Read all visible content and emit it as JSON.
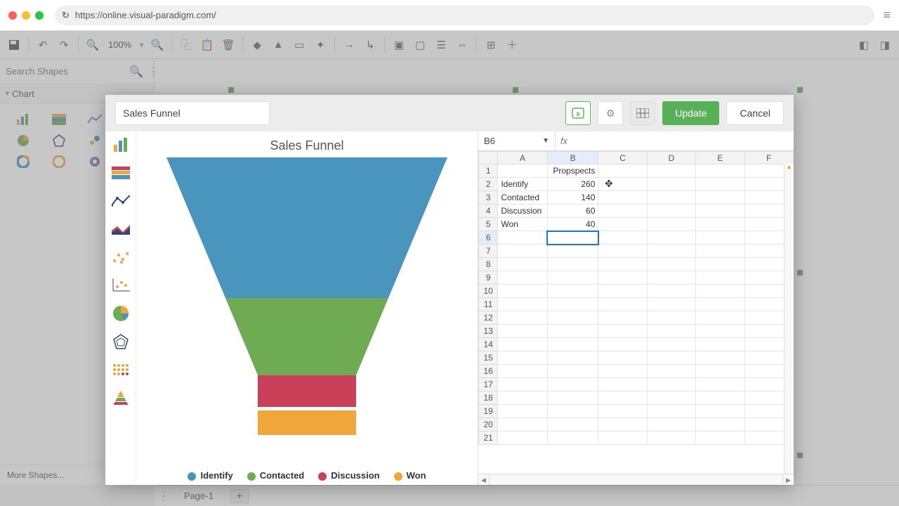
{
  "browser": {
    "url": "https://online.visual-paradigm.com/"
  },
  "toolbar": {
    "zoom": "100%"
  },
  "sidebar": {
    "search_placeholder": "Search Shapes",
    "category": "Chart",
    "more": "More Shapes..."
  },
  "page_tab": "Page-1",
  "modal": {
    "title_input": "Sales Funnel",
    "update": "Update",
    "cancel": "Cancel",
    "chart_title": "Sales Funnel"
  },
  "legend": {
    "l1": "Identify",
    "l2": "Contacted",
    "l3": "Discussion",
    "l4": "Won"
  },
  "colors": {
    "identify": "#4a95bd",
    "contacted": "#6eab52",
    "discussion": "#c94058",
    "won": "#f0a63b"
  },
  "sheet": {
    "cellref": "B6",
    "cols": [
      "A",
      "B",
      "C",
      "D",
      "E",
      "F"
    ],
    "b1": "Propspects",
    "a2": "Identify",
    "b2": "260",
    "a3": "Contacted",
    "b3": "140",
    "a4": "Discussion",
    "b4": "60",
    "a5": "Won",
    "b5": "40"
  },
  "chart_data": {
    "type": "funnel",
    "title": "Sales Funnel",
    "series_name": "Propspects",
    "categories": [
      "Identify",
      "Contacted",
      "Discussion",
      "Won"
    ],
    "values": [
      260,
      140,
      60,
      40
    ],
    "colors": [
      "#4a95bd",
      "#6eab52",
      "#c94058",
      "#f0a63b"
    ]
  }
}
